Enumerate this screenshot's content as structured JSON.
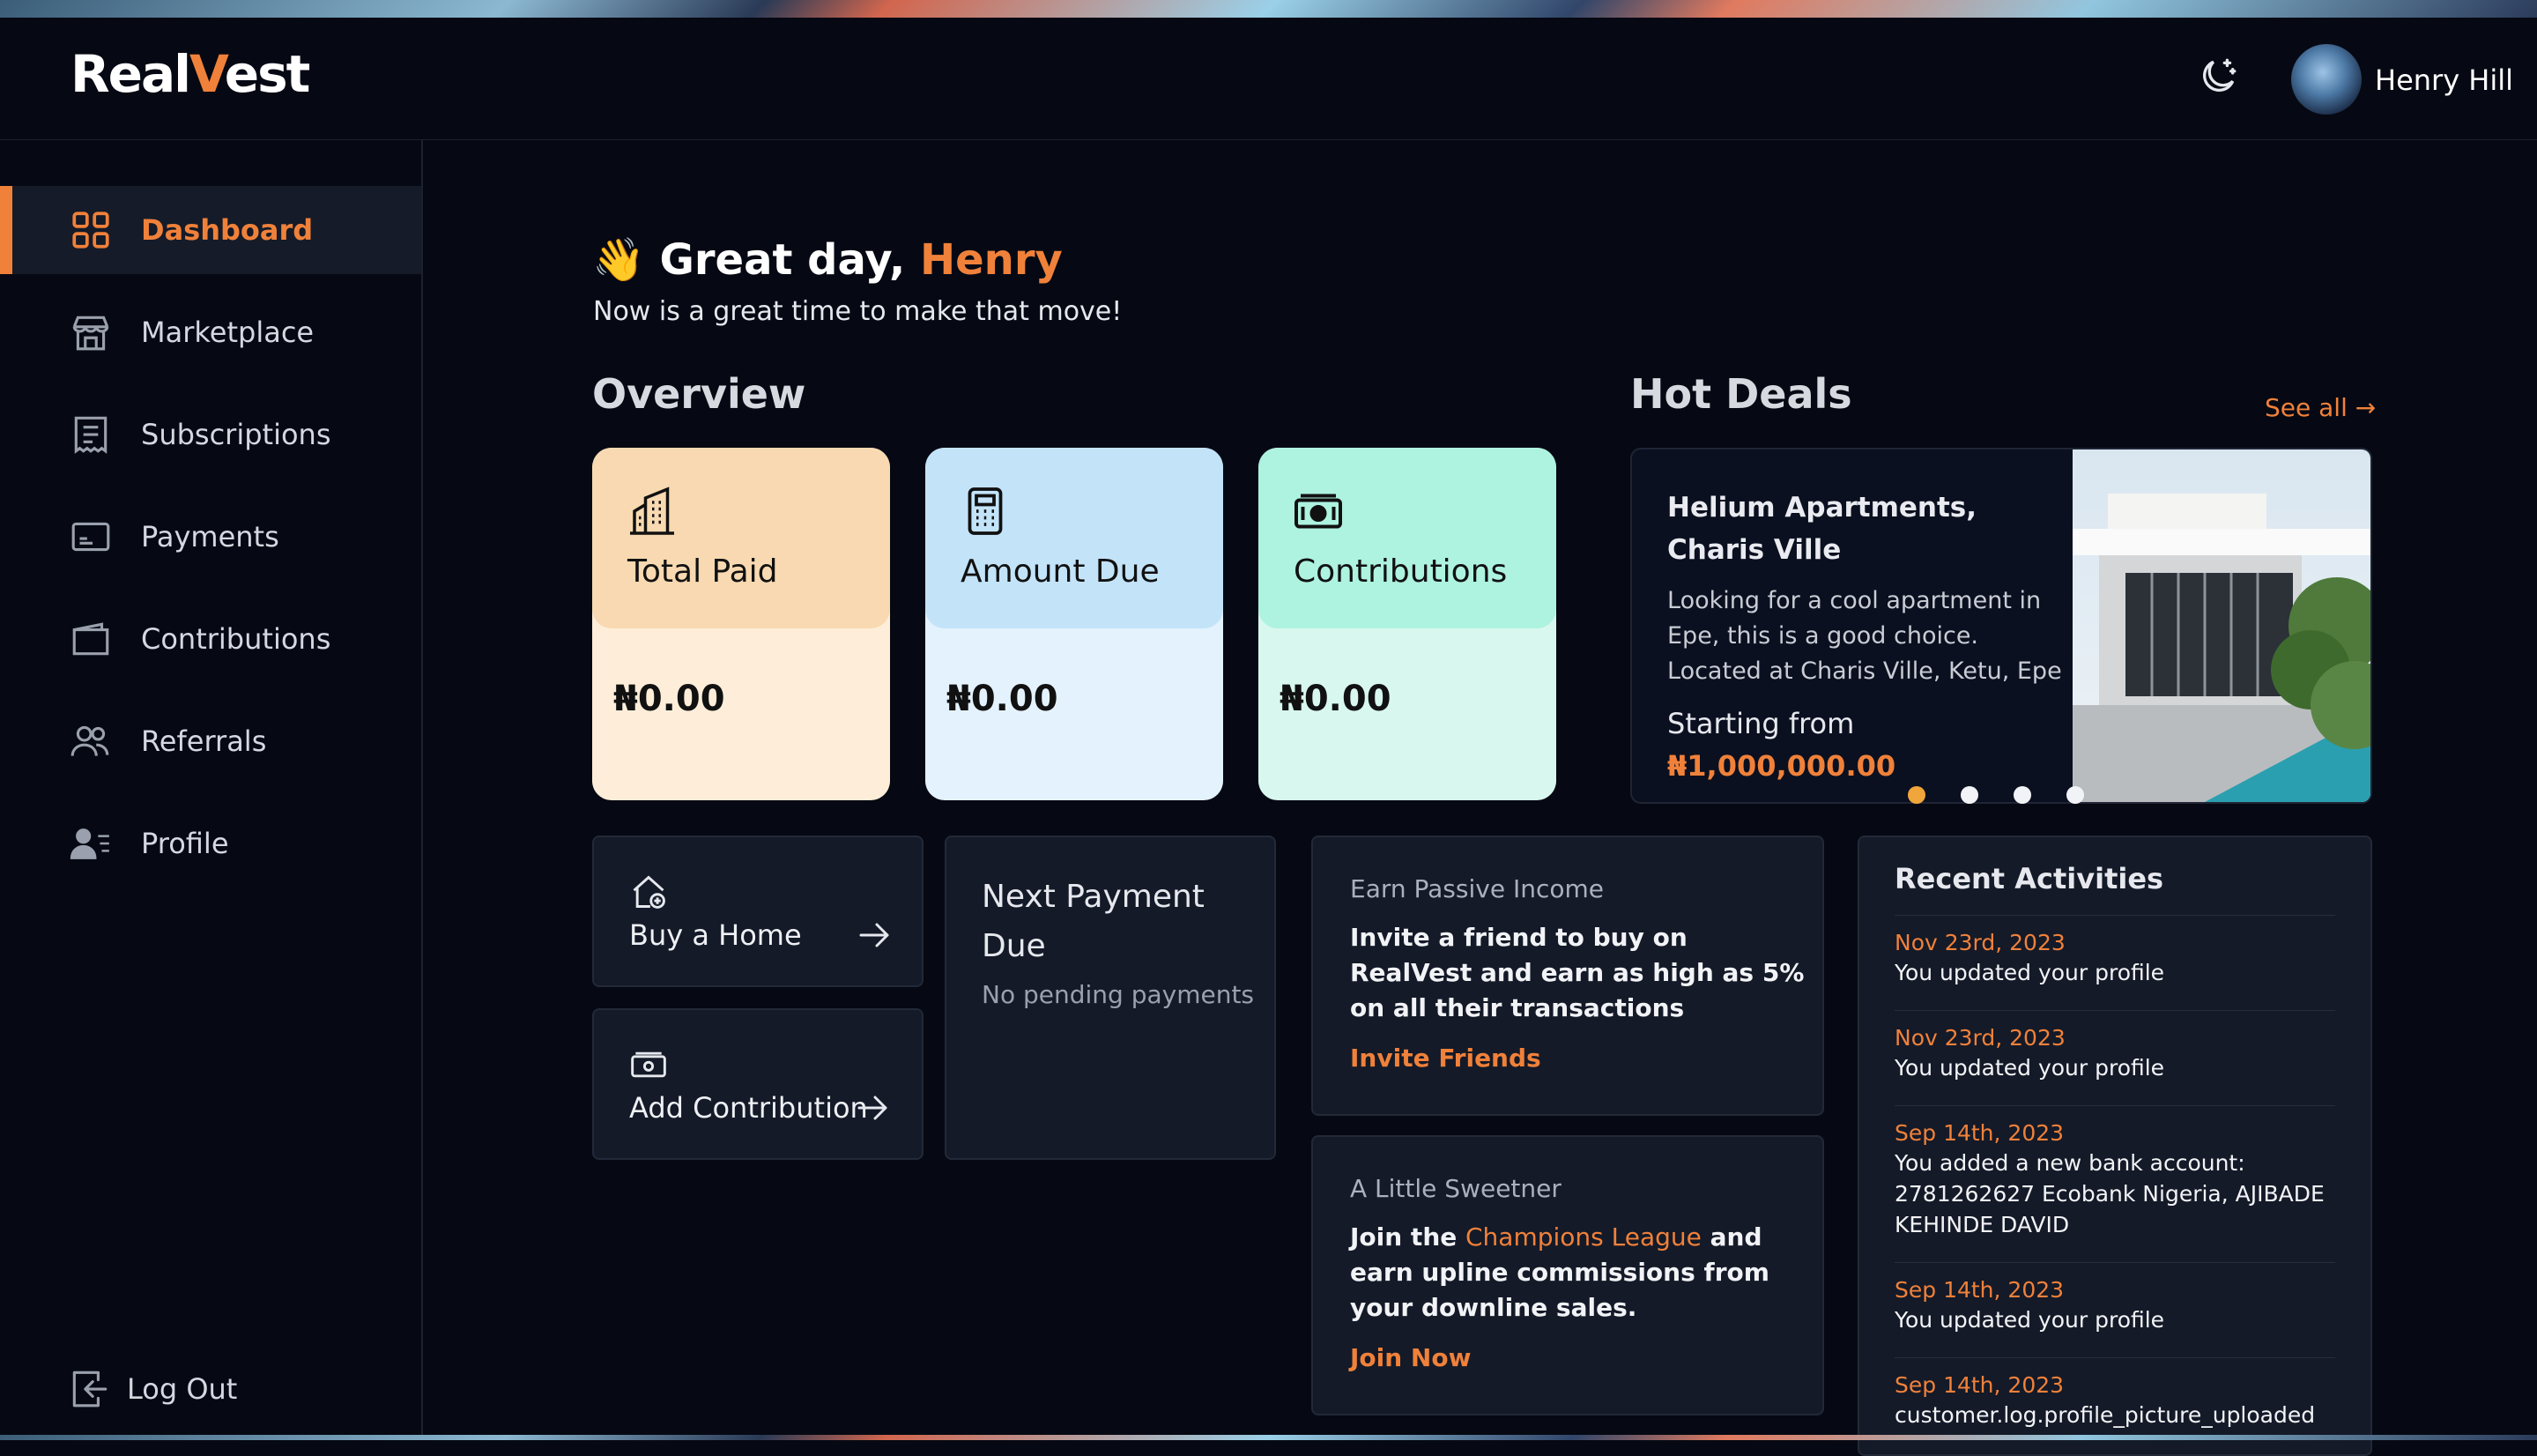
{
  "app": {
    "logo_prefix": "Real",
    "logo_v": "V",
    "logo_suffix": "est"
  },
  "header": {
    "user_name": "Henry Hill"
  },
  "sidebar": {
    "items": [
      {
        "label": "Dashboard",
        "icon": "grid-icon",
        "active": true
      },
      {
        "label": "Marketplace",
        "icon": "store-icon"
      },
      {
        "label": "Subscriptions",
        "icon": "receipt-icon"
      },
      {
        "label": "Payments",
        "icon": "card-icon"
      },
      {
        "label": "Contributions",
        "icon": "wallet-icon"
      },
      {
        "label": "Referrals",
        "icon": "users-icon"
      },
      {
        "label": "Profile",
        "icon": "user-list-icon"
      }
    ],
    "logout_label": "Log Out"
  },
  "greeting": {
    "emoji": "👋",
    "prefix": "Great day, ",
    "name": "Henry",
    "subtitle": "Now is a great time to make that move!"
  },
  "overview": {
    "title": "Overview",
    "cards": [
      {
        "label": "Total Paid",
        "amount": "₦0.00",
        "head_color": "#f8d9b1",
        "body_color": "#feeed9"
      },
      {
        "label": "Amount Due",
        "amount": "₦0.00",
        "head_color": "#c3e3f9",
        "body_color": "#e4f2fd"
      },
      {
        "label": "Contributions",
        "amount": "₦0.00",
        "head_color": "#aef2e0",
        "body_color": "#d8f8ef"
      }
    ]
  },
  "hot_deals": {
    "title": "Hot Deals",
    "see_all": "See all →",
    "deal": {
      "title": "Helium Apartments, Charis Ville",
      "description": "Looking for a cool apartment in Epe, this is a good choice. Located at Charis Ville, Ketu, Epe",
      "starting_label": "Starting from",
      "price": "₦1,000,000.00"
    },
    "active_slide": 1,
    "slide_count": 4
  },
  "quick_actions": {
    "buy_home": "Buy a Home",
    "add_contribution": "Add Contribution"
  },
  "next_payment": {
    "title": "Next Payment Due",
    "subtitle": "No pending payments"
  },
  "passive_income": {
    "title": "Earn Passive Income",
    "body": "Invite a friend to buy on RealVest and earn as high as 5% on all their transactions",
    "link": "Invite Friends"
  },
  "sweetener": {
    "title": "A Little Sweetner",
    "body_prefix": "Join the ",
    "highlight": "Champions League",
    "body_suffix": " and earn upline commissions from your downline sales.",
    "link": "Join Now"
  },
  "recent_activities": {
    "title": "Recent Activities",
    "items": [
      {
        "date": "Nov 23rd, 2023",
        "text": "You updated your profile"
      },
      {
        "date": "Nov 23rd, 2023",
        "text": "You updated your profile"
      },
      {
        "date": "Sep 14th, 2023",
        "text": "You added a new bank account: 2781262627 Ecobank Nigeria, AJIBADE KEHINDE DAVID"
      },
      {
        "date": "Sep 14th, 2023",
        "text": "You updated your profile"
      },
      {
        "date": "Sep 14th, 2023",
        "text": "customer.log.profile_picture_uploaded"
      }
    ]
  },
  "colors": {
    "accent": "#f0813a",
    "background": "#060913",
    "panel": "#141a28"
  }
}
